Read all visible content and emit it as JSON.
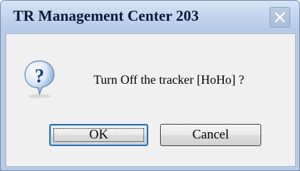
{
  "window": {
    "title": "TR Management Center 203"
  },
  "titlebar": {
    "close_icon": "close-icon"
  },
  "dialog": {
    "icon": "question-icon",
    "message": "Turn Off the tracker [HoHo] ?"
  },
  "buttons": {
    "ok_label": "OK",
    "cancel_label": "Cancel"
  },
  "colors": {
    "titlebar": "#c5d7ee",
    "client_bg": "#f0f0f0",
    "focus_border": "#2b6fb3"
  }
}
